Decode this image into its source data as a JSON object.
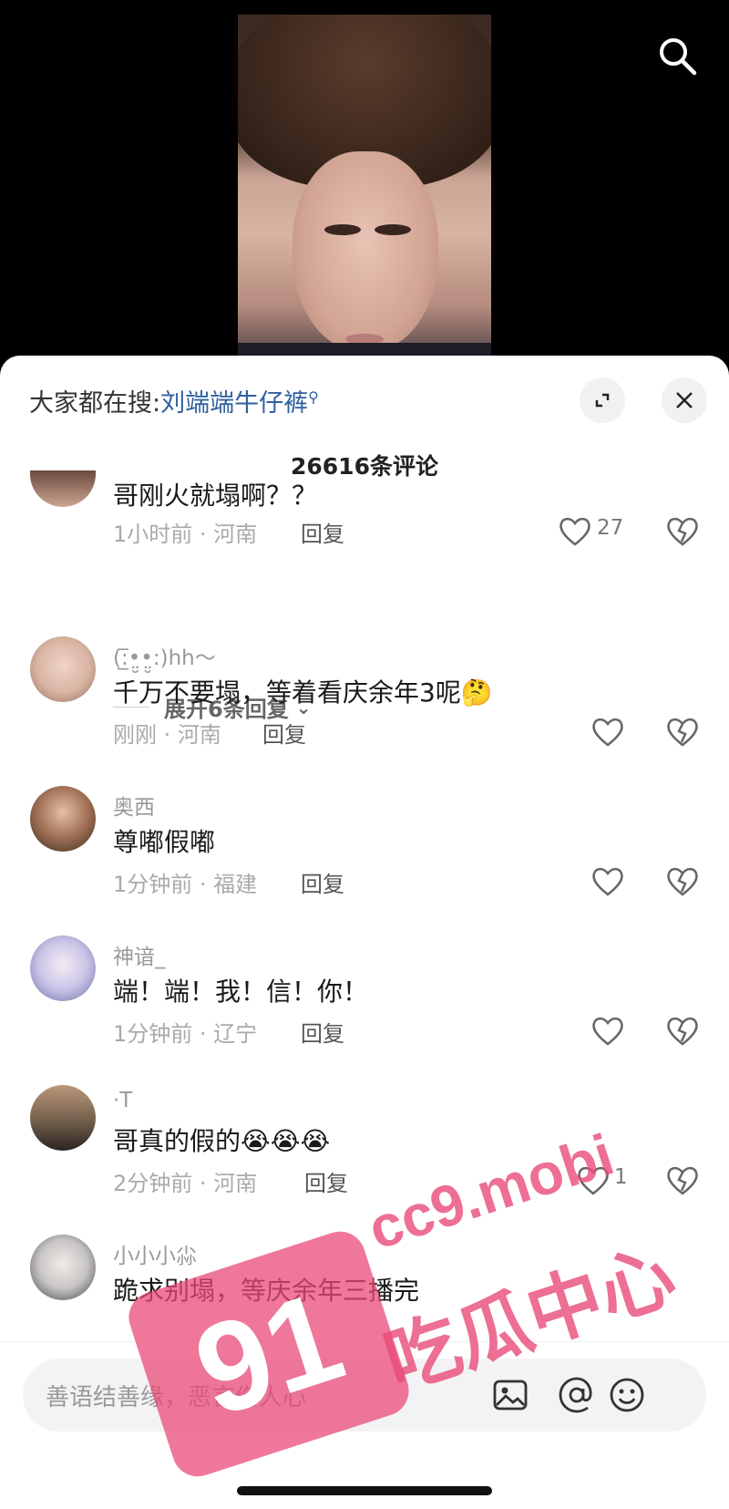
{
  "header": {
    "hot_search_prefix": "大家都在搜:",
    "hot_search_term": "刘端端牛仔裤"
  },
  "comment_count": "26616条评论",
  "comments": [
    {
      "text": "哥刚火就塌啊？？",
      "time": "1小时前",
      "location": "河南",
      "reply_label": "回复",
      "likes": "27"
    },
    {
      "username": "(:̲̅•̤̮•̤̮:)hh～",
      "text": "千万不要塌，等着看庆余年3呢",
      "emoji": "🤔",
      "time": "刚刚",
      "location": "河南",
      "reply_label": "回复"
    },
    {
      "username": "奥西",
      "text": "尊嘟假嘟",
      "time": "1分钟前",
      "location": "福建",
      "reply_label": "回复"
    },
    {
      "username": "神谙_",
      "text": "端！端！我！信！你！",
      "time": "1分钟前",
      "location": "辽宁",
      "reply_label": "回复"
    },
    {
      "username": "·T",
      "text": "哥真的假的",
      "emoji": "😭😭😭",
      "time": "2分钟前",
      "location": "河南",
      "reply_label": "回复",
      "likes": "1"
    },
    {
      "username": "小小小尛",
      "text": "跪求别塌，等庆余年三播完"
    }
  ],
  "expand_replies": "展开6条回复",
  "input": {
    "placeholder": "善语结善缘，恶言伤人心"
  },
  "watermark": {
    "logo_number": "91",
    "url": "cc9.mobi",
    "label": "吃瓜中心"
  },
  "accent_color": "#2f5f9e",
  "watermark_color": "#e94b78"
}
